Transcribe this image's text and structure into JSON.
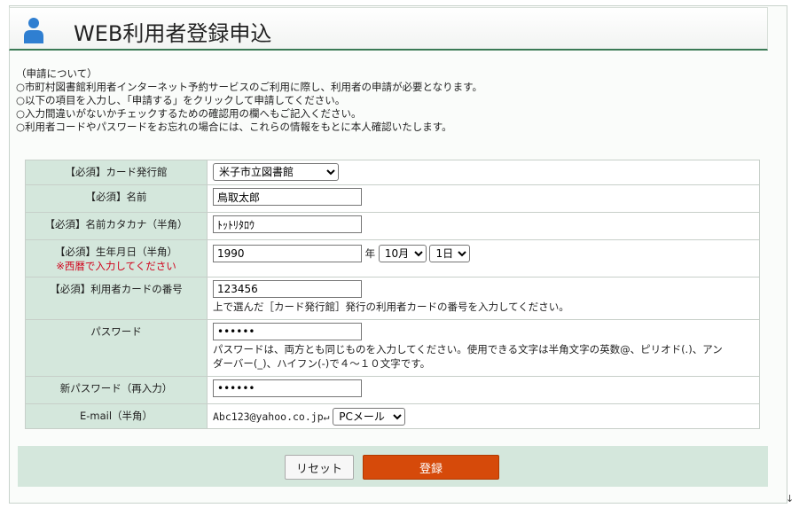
{
  "header": {
    "title": "WEB利用者登録申込",
    "icon": "user-icon"
  },
  "intro": {
    "lines": [
      "（申請について）",
      "○市町村図書館利用者インターネット予約サービスのご利用に際し、利用者の申請が必要となります。",
      "○以下の項目を入力し、「申請する」をクリックして申請してください。",
      "○入力間違いがないかチェックするための確認用の欄へもご記入ください。",
      "○利用者コードやパスワードをお忘れの場合には、これらの情報をもとに本人確認いたします。"
    ]
  },
  "form": {
    "library": {
      "label": "【必須】カード発行館",
      "value": "米子市立図書館"
    },
    "name": {
      "label": "【必須】名前",
      "value": "鳥取太郎"
    },
    "kana": {
      "label": "【必須】名前カタカナ（半角）",
      "value": "ﾄｯﾄﾘﾀﾛｳ"
    },
    "birth": {
      "label": "【必須】生年月日（半角）",
      "note": "※西暦で入力してください",
      "year": "1990",
      "year_unit": "年",
      "month": "10月",
      "day": "1日"
    },
    "card": {
      "label": "【必須】利用者カードの番号",
      "value": "123456",
      "help": "上で選んだ［カード発行館］発行の利用者カードの番号を入力してください。"
    },
    "password": {
      "label": "パスワード",
      "value": "••••••",
      "help1": "パスワードは、両方とも同じものを入力してください。使用できる文字は半角文字の英数@、ピリオド(.)、アン",
      "help2": "ダーバー(_)、ハイフン(-)で４～１０文字です。"
    },
    "password2": {
      "label": "新パスワード（再入力）",
      "value": "••••••"
    },
    "email": {
      "label": "E-mail（半角）",
      "value": "Abc123@yahoo.co.jp↵",
      "type": "PCメール"
    }
  },
  "buttons": {
    "reset": "リセット",
    "submit": "登録"
  },
  "colors": {
    "accent": "#d64a0a",
    "label_bg": "#d4e7dc",
    "header_line": "#3a7a55"
  },
  "corner": "↓"
}
